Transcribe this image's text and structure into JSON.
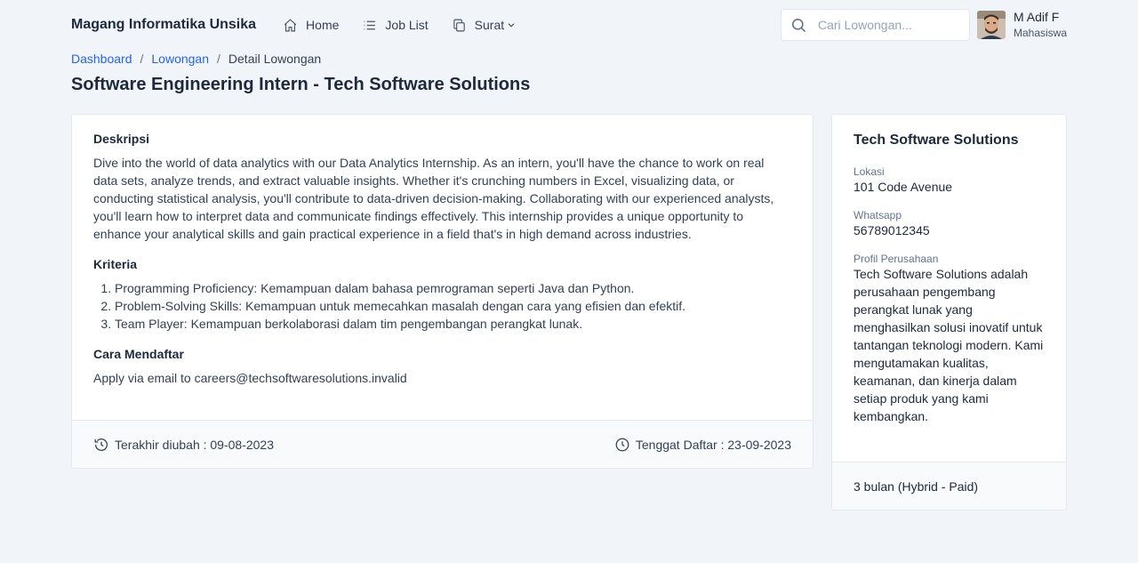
{
  "header": {
    "brand": "Magang Informatika Unsika",
    "nav": [
      {
        "label": "Home",
        "icon": "home-icon"
      },
      {
        "label": "Job List",
        "icon": "list-icon"
      },
      {
        "label": "Surat",
        "icon": "copy-icon"
      }
    ],
    "search_placeholder": "Cari Lowongan...",
    "user": {
      "name": "M Adif F",
      "role": "Mahasiswa"
    }
  },
  "breadcrumb": {
    "items": [
      "Dashboard",
      "Lowongan"
    ],
    "current": "Detail Lowongan"
  },
  "page_title": "Software Engineering Intern - Tech Software Solutions",
  "detail": {
    "desc_title": "Deskripsi",
    "description": "Dive into the world of data analytics with our Data Analytics Internship. As an intern, you'll have the chance to work on real data sets, analyze trends, and extract valuable insights. Whether it's crunching numbers in Excel, visualizing data, or conducting statistical analysis, you'll contribute to data-driven decision-making. Collaborating with our experienced analysts, you'll learn how to interpret data and communicate findings effectively. This internship provides a unique opportunity to enhance your analytical skills and gain practical experience in a field that's in high demand across industries.",
    "criteria_title": "Kriteria",
    "criteria": [
      "Programming Proficiency: Kemampuan dalam bahasa pemrograman seperti Java dan Python.",
      "Problem-Solving Skills: Kemampuan untuk memecahkan masalah dengan cara yang efisien dan efektif.",
      "Team Player: Kemampuan berkolaborasi dalam tim pengembangan perangkat lunak."
    ],
    "apply_title": "Cara Mendaftar",
    "apply_text": "Apply via email to careers@techsoftwaresolutions.invalid",
    "last_updated": "Terakhir diubah : 09-08-2023",
    "deadline": "Tenggat Daftar : 23-09-2023"
  },
  "company": {
    "name": "Tech Software Solutions",
    "location_label": "Lokasi",
    "location": "101 Code Avenue",
    "whatsapp_label": "Whatsapp",
    "whatsapp": "56789012345",
    "profile_label": "Profil Perusahaan",
    "profile": "Tech Software Solutions adalah perusahaan pengembang perangkat lunak yang menghasilkan solusi inovatif untuk tantangan teknologi modern. Kami mengutamakan kualitas, keamanan, dan kinerja dalam setiap produk yang kami kembangkan.",
    "duration": "3 bulan (Hybrid - Paid)"
  },
  "colors": {
    "background": "#f1f5f9",
    "link": "#2563eb",
    "text": "#1e293b"
  }
}
